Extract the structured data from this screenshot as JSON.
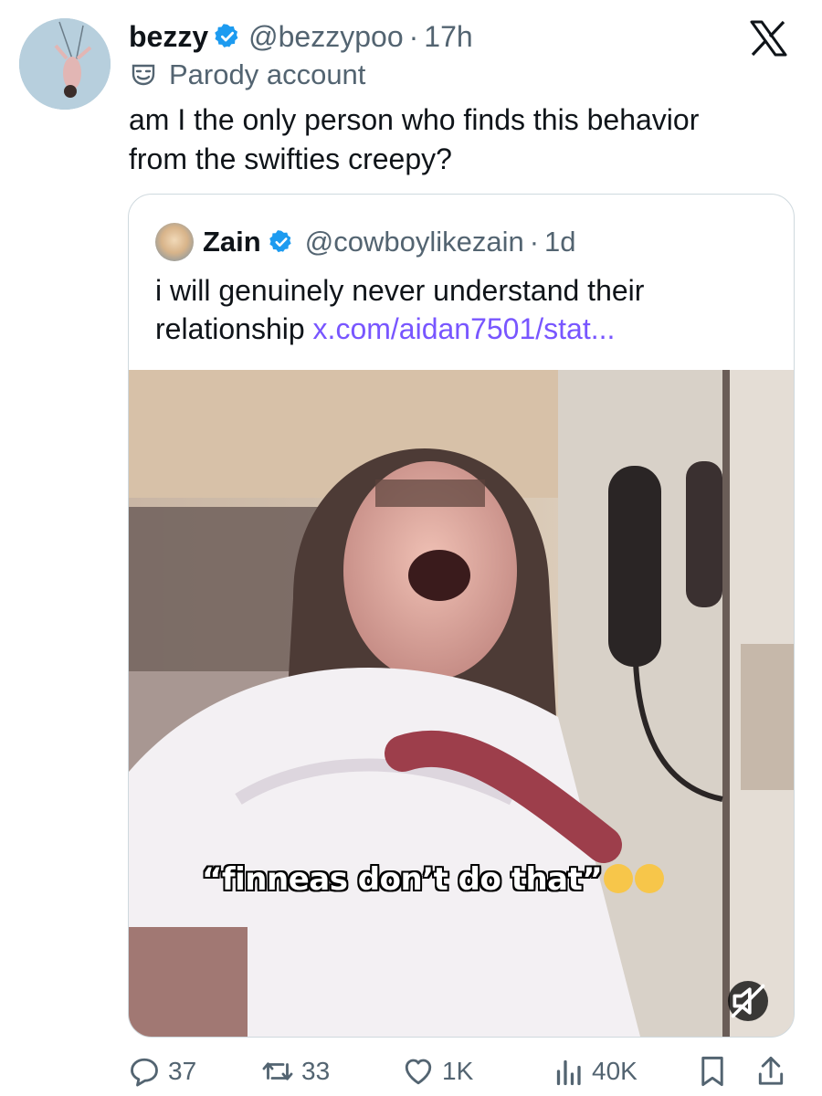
{
  "tweet": {
    "display_name": "bezzy",
    "handle": "@bezzypoo",
    "separator": "·",
    "time": "17h",
    "account_label": "Parody account",
    "text_line1": "am I the only person who finds this behavior",
    "text_line2": "from the swifties creepy?"
  },
  "quoted": {
    "display_name": "Zain",
    "handle": "@cowboylikezain",
    "separator": "·",
    "time": "1d",
    "text_line1": "i will genuinely never understand their",
    "text_line2_plain": "relationship ",
    "link_text": "x.com/aidan7501/stat...",
    "video_caption": "“finneas don’t do that”"
  },
  "actions": {
    "replies": "37",
    "reposts": "33",
    "likes": "1K",
    "views": "40K"
  },
  "icons": {
    "verified": "verified-badge-icon",
    "x_logo": "x-logo-icon",
    "parody": "theater-mask-icon",
    "reply": "reply-icon",
    "repost": "repost-icon",
    "like": "heart-icon",
    "views": "views-chart-icon",
    "bookmark": "bookmark-icon",
    "share": "share-icon",
    "mute": "muted-speaker-icon"
  },
  "colors": {
    "verified_blue": "#1d9bf0",
    "link_purple": "#7856ff",
    "secondary_text": "#536471"
  }
}
